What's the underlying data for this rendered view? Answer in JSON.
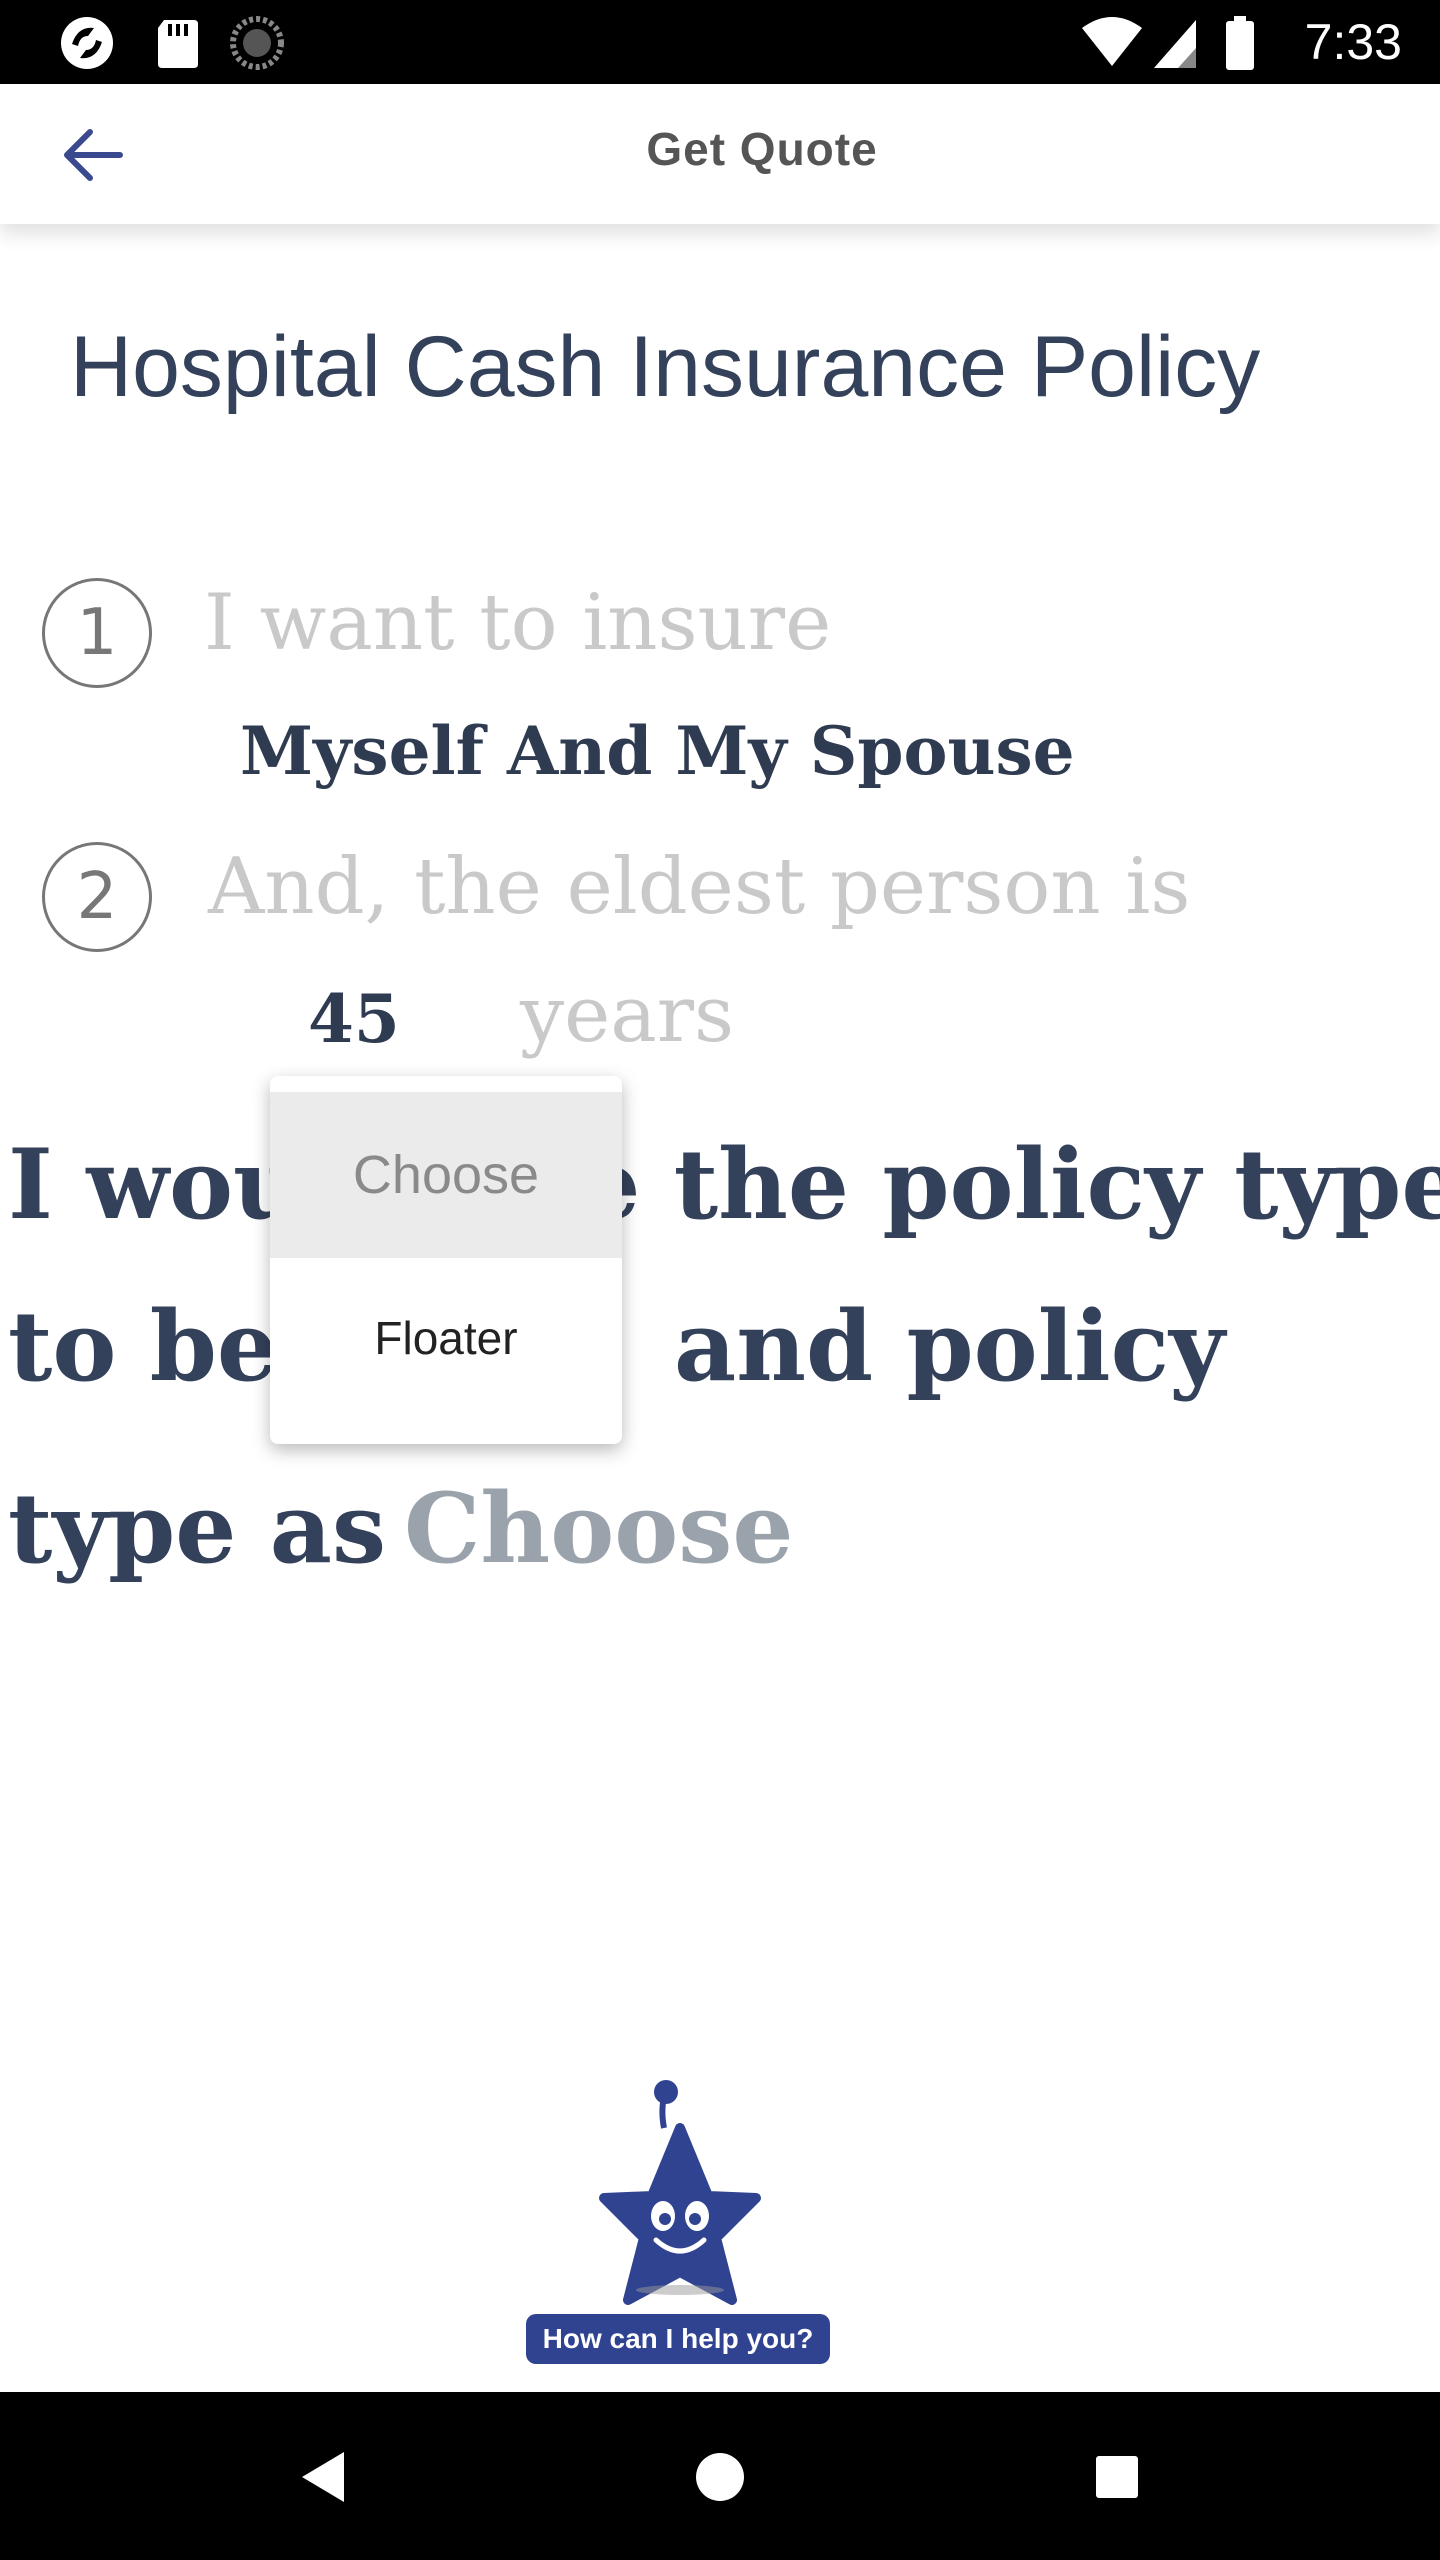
{
  "status_bar": {
    "time": "7:33",
    "left_icons": [
      "app-notification-icon",
      "sd-card-icon",
      "sync-icon"
    ],
    "right_icons": [
      "wifi-icon",
      "signal-icon",
      "battery-icon"
    ]
  },
  "app_bar": {
    "back_icon": "arrow-left-icon",
    "title": "Get Quote"
  },
  "page": {
    "title": "Hospital Cash Insurance Policy",
    "step1": {
      "number": "1",
      "question": "I want to insure",
      "answer": "Myself And My Spouse"
    },
    "step2": {
      "number": "2",
      "question": "And, the eldest person is",
      "age": "45",
      "unit": "years"
    },
    "sentence": {
      "line1": "I would like the policy type",
      "line2_start": "to be",
      "line2_end": "and policy",
      "line3_start": "type as",
      "line3_choose": "Choose"
    }
  },
  "dropdown": {
    "options": [
      "Choose",
      "Floater"
    ],
    "highlighted": "Choose"
  },
  "assistant": {
    "label": "How can I help you?",
    "brand_color": "#2f4391"
  },
  "nav_bar": {
    "buttons": [
      "back-triangle-icon",
      "home-circle-icon",
      "recents-square-icon"
    ]
  }
}
